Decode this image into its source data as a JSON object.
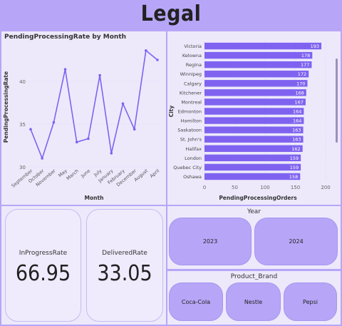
{
  "page": {
    "title": "Legal"
  },
  "colors": {
    "background": "#b7a6f7",
    "panel": "#ede9fb",
    "accent": "#7f63f0",
    "tile": "#b7a6f7"
  },
  "line_panel": {
    "title": "PendingProcessingRate by Month"
  },
  "bar_panel": {},
  "cards": {
    "inprogress": {
      "label": "InProgressRate",
      "value": "66.95"
    },
    "delivered": {
      "label": "DeliveredRate",
      "value": "33.05"
    }
  },
  "year_slicer": {
    "title": "Year",
    "options": [
      "2023",
      "2024"
    ]
  },
  "brand_slicer": {
    "title": "Product_Brand",
    "options": [
      "Coca-Cola",
      "Nestle",
      "Pepsi"
    ]
  },
  "chart_data": [
    {
      "type": "line",
      "title": "PendingProcessingRate by Month",
      "xlabel": "Month",
      "ylabel": "PendingProcessingRate",
      "categories": [
        "September",
        "October",
        "November",
        "May",
        "March",
        "June",
        "July",
        "January",
        "February",
        "December",
        "August",
        "April"
      ],
      "values": [
        34.4,
        31.0,
        35.2,
        41.4,
        32.9,
        33.3,
        40.7,
        31.6,
        37.4,
        34.4,
        43.6,
        42.5
      ],
      "ylim": [
        30,
        44
      ],
      "yticks": [
        30,
        35,
        40
      ],
      "grid": true
    },
    {
      "type": "bar",
      "orientation": "horizontal",
      "xlabel": "PendingProcessingOrders",
      "ylabel": "City",
      "categories": [
        "Victoria",
        "Kelowna",
        "Regina",
        "Winnipeg",
        "Calgary",
        "Kitchener",
        "Montreal",
        "Edmonton",
        "Hamilton",
        "Saskatoon",
        "St. John's",
        "Halifax",
        "London",
        "Quebec City",
        "Oshawa"
      ],
      "values": [
        193,
        178,
        177,
        172,
        170,
        168,
        167,
        164,
        164,
        163,
        163,
        162,
        159,
        159,
        158
      ],
      "xlim": [
        0,
        200
      ],
      "xticks": [
        0,
        50,
        100,
        150,
        200
      ],
      "grid": true
    }
  ]
}
